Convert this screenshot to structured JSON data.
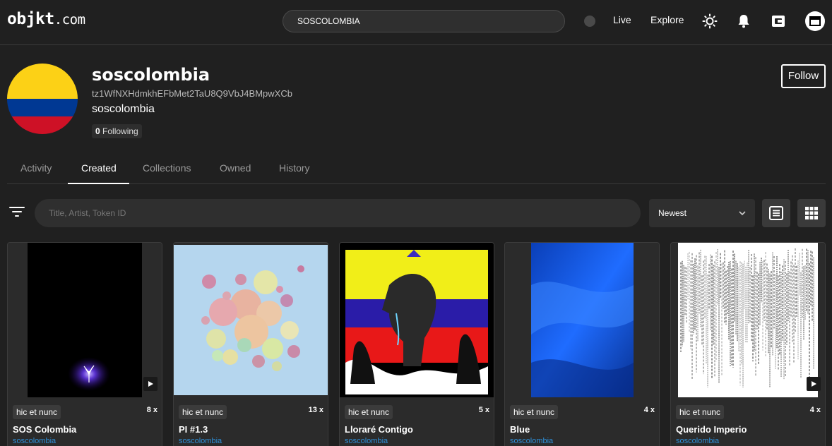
{
  "header": {
    "logo_main": "objkt",
    "logo_suffix": ".com",
    "search_value": "SOSCOLOMBIA",
    "nav_live": "Live",
    "nav_explore": "Explore",
    "icons": [
      "sun-icon",
      "bell-icon",
      "wallet-icon",
      "account-icon"
    ]
  },
  "profile": {
    "name": "soscolombia",
    "address": "tz1WfNXHdmkhEFbMet2TaU8Q9VbJ4BMpwXCb",
    "alias": "soscolombia",
    "following_count": "0",
    "following_label": "Following",
    "follow_button": "Follow",
    "avatar_colors": [
      "#fcd116",
      "#003893",
      "#ce1126"
    ]
  },
  "tabs": [
    {
      "label": "Activity",
      "active": false
    },
    {
      "label": "Created",
      "active": true
    },
    {
      "label": "Collections",
      "active": false
    },
    {
      "label": "Owned",
      "active": false
    },
    {
      "label": "History",
      "active": false
    }
  ],
  "filters": {
    "search_placeholder": "Title, Artist, Token ID",
    "sort_value": "Newest"
  },
  "tokens": [
    {
      "title": "SOS Colombia",
      "artist": "soscolombia",
      "platform": "hic et nunc",
      "edition": "8 x",
      "has_video": true
    },
    {
      "title": "PI #1.3",
      "artist": "soscolombia",
      "platform": "hic et nunc",
      "edition": "13 x",
      "has_video": false
    },
    {
      "title": "Lloraré Contigo",
      "artist": "soscolombia",
      "platform": "hic et nunc",
      "edition": "5 x",
      "has_video": false
    },
    {
      "title": "Blue",
      "artist": "soscolombia",
      "platform": "hic et nunc",
      "edition": "4 x",
      "has_video": false
    },
    {
      "title": "Querido Imperio",
      "artist": "soscolombia",
      "platform": "hic et nunc",
      "edition": "4 x",
      "has_video": true
    }
  ]
}
